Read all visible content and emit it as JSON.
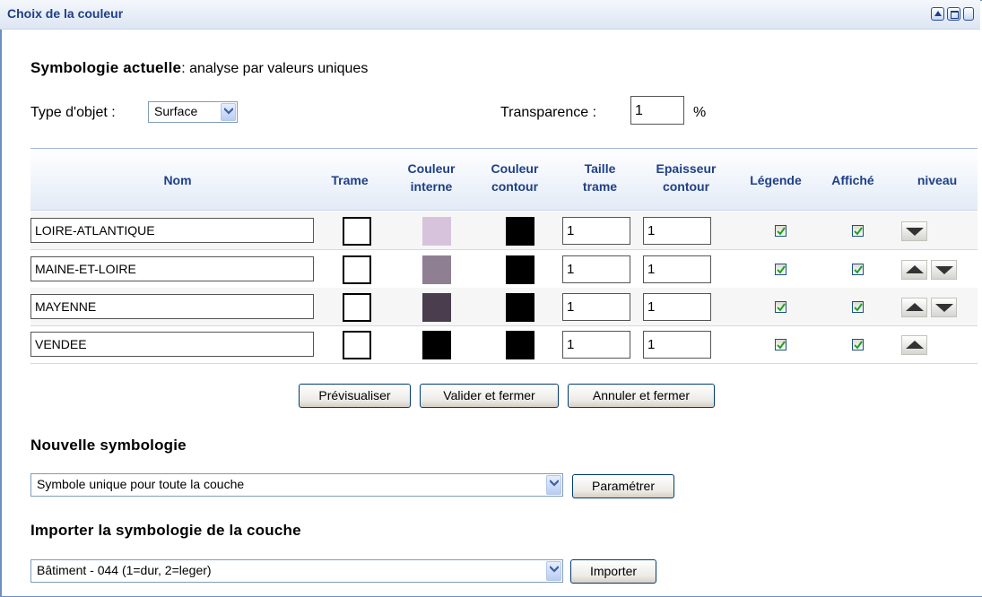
{
  "window": {
    "title": "Choix de la couleur"
  },
  "symbologie_actuelle": {
    "label": "Symbologie actuelle",
    "value": ": analyse par valeurs uniques"
  },
  "type_objet": {
    "label": "Type d'objet :",
    "value": "Surface"
  },
  "transparence": {
    "label": "Transparence :",
    "value": "1",
    "unit": "%"
  },
  "table": {
    "headers": {
      "nom": "Nom",
      "trame": "Trame",
      "couleur_interne_1": "Couleur",
      "couleur_interne_2": "interne",
      "couleur_contour_1": "Couleur",
      "couleur_contour_2": "contour",
      "taille_trame_1": "Taille",
      "taille_trame_2": "trame",
      "epaisseur_1": "Epaisseur",
      "epaisseur_2": "contour",
      "legende": "Légende",
      "affiche": "Affiché",
      "niveau": "niveau"
    },
    "rows": [
      {
        "nom": "LOIRE-ATLANTIQUE",
        "couleur_interne": "#d7c4dc",
        "couleur_contour": "#000000",
        "taille_trame": "1",
        "epaisseur_contour": "1",
        "legende": true,
        "affiche": true,
        "up": false,
        "down": true
      },
      {
        "nom": "MAINE-ET-LOIRE",
        "couleur_interne": "#8e7f92",
        "couleur_contour": "#000000",
        "taille_trame": "1",
        "epaisseur_contour": "1",
        "legende": true,
        "affiche": true,
        "up": true,
        "down": true
      },
      {
        "nom": "MAYENNE",
        "couleur_interne": "#4a3d4d",
        "couleur_contour": "#000000",
        "taille_trame": "1",
        "epaisseur_contour": "1",
        "legende": true,
        "affiche": true,
        "up": true,
        "down": true
      },
      {
        "nom": "VENDEE",
        "couleur_interne": "#000000",
        "couleur_contour": "#000000",
        "taille_trame": "1",
        "epaisseur_contour": "1",
        "legende": true,
        "affiche": true,
        "up": true,
        "down": false
      }
    ]
  },
  "actions": {
    "previsualiser": "Prévisualiser",
    "valider": "Valider et fermer",
    "annuler": "Annuler et fermer"
  },
  "nouvelle_symbologie": {
    "heading": "Nouvelle symbologie",
    "value": "Symbole unique pour toute la couche",
    "button": "Paramétrer"
  },
  "importer": {
    "heading": "Importer la symbologie de la couche",
    "value": "Bâtiment - 044 (1=dur, 2=leger)",
    "button": "Importer"
  },
  "colors": {
    "title": "#1f3f86",
    "header_text": "#1f3f86",
    "check": "#21a121"
  },
  "icons": [
    "collapse-icon",
    "restore-icon",
    "dropdown-arrow-icon",
    "checkmark-icon",
    "arrow-up-icon",
    "arrow-down-icon"
  ]
}
